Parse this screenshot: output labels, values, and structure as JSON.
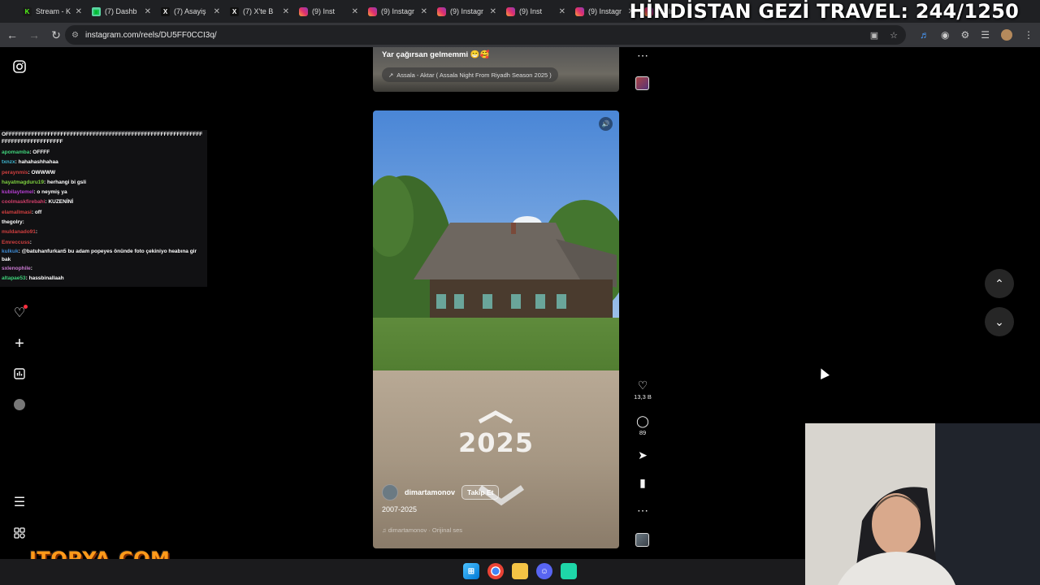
{
  "overlay_title": "HİNDİSTAN GEZİ TRAVEL: 244/1250",
  "tabs": [
    {
      "icon": "kick-icon",
      "label": "Stream - K"
    },
    {
      "icon": "dashboard-icon",
      "label": "(7) Dashb"
    },
    {
      "icon": "x-icon",
      "label": "(7) Asayiş"
    },
    {
      "icon": "x-icon",
      "label": "(7) X'te B"
    },
    {
      "icon": "instagram-icon",
      "label": "(9) Inst"
    },
    {
      "icon": "instagram-icon",
      "label": "(9) Instagr"
    },
    {
      "icon": "instagram-icon",
      "label": "(9) Instagr"
    },
    {
      "icon": "instagram-icon",
      "label": "(9) Inst"
    },
    {
      "icon": "instagram-icon",
      "label": "(9) Instagr"
    },
    {
      "icon": "instagram-icon",
      "label": "(9) In"
    }
  ],
  "address_bar": {
    "url": "instagram.com/reels/DU5FF0CCI3q/"
  },
  "chat": {
    "spam": "OFFFFFFFFFFFFFFFFFFFFFFFFFFFFFFFFFFFFFFFFFFFFFFFFFFFFFFFFFFFFFFFFFFFFFFFFFFFFFFFF",
    "messages": [
      {
        "user": "apomamba",
        "text": ": OFFFF",
        "color": "#3fd17a"
      },
      {
        "user": "txnzx",
        "text": ": hahahashhahaa",
        "color": "#3fb7d1"
      },
      {
        "user": "peraynmis",
        "text": ": OWWWW",
        "color": "#d13f3f"
      },
      {
        "user": "hayatmagduru19",
        "text": ": herhangi bi gsli",
        "color": "#7ed13f"
      },
      {
        "user": "kubilaytemel",
        "text": ": o neymiş ya",
        "color": "#b53fd1"
      },
      {
        "user": "coolmaskfirebahi",
        "text": ": KUZENİNİ",
        "color": "#d13f6a"
      },
      {
        "user": "elamallmasi",
        "text": ": off",
        "color": "#d13f3f"
      },
      {
        "user": "thegolry",
        "text": ": ",
        "color": "#ffffff"
      },
      {
        "user": "muldanado91",
        "text": ": ",
        "color": "#d13f3f"
      },
      {
        "user": "Emreccuss",
        "text": ": ",
        "color": "#d13f3f"
      },
      {
        "user": "kulkuk",
        "text": ": @batuhanfurkan5 bu adam popeyes önünde foto çekiniyo heabına gir bak",
        "color": "#3f8ad1"
      },
      {
        "user": "sxlenophile",
        "text": ": ",
        "color": "#c97ad1"
      },
      {
        "user": "altapae53",
        "text": ": hassbinallaah",
        "color": "#3fd17a"
      }
    ]
  },
  "reel_prev": {
    "caption": "Yar çağırsan gelmemmi 😁🥰",
    "song": "Assala - Aktar ( Assala Night From Riyadh Season 2025 )"
  },
  "reel": {
    "year_text": "2025",
    "author": "dimartamonov",
    "follow_label": "Takip Et",
    "caption": "2007-2025",
    "audio": "dimartamonov · Orijinal ses"
  },
  "actions": {
    "likes": "13,3 B",
    "comments": "89"
  },
  "logo_text": "ITOPYA.COM",
  "colors": {
    "bg": "#000000",
    "tabbar": "#1f2023",
    "addrbar": "#35363a",
    "notification": "#ff3040",
    "logo": "#ff9a1a"
  }
}
